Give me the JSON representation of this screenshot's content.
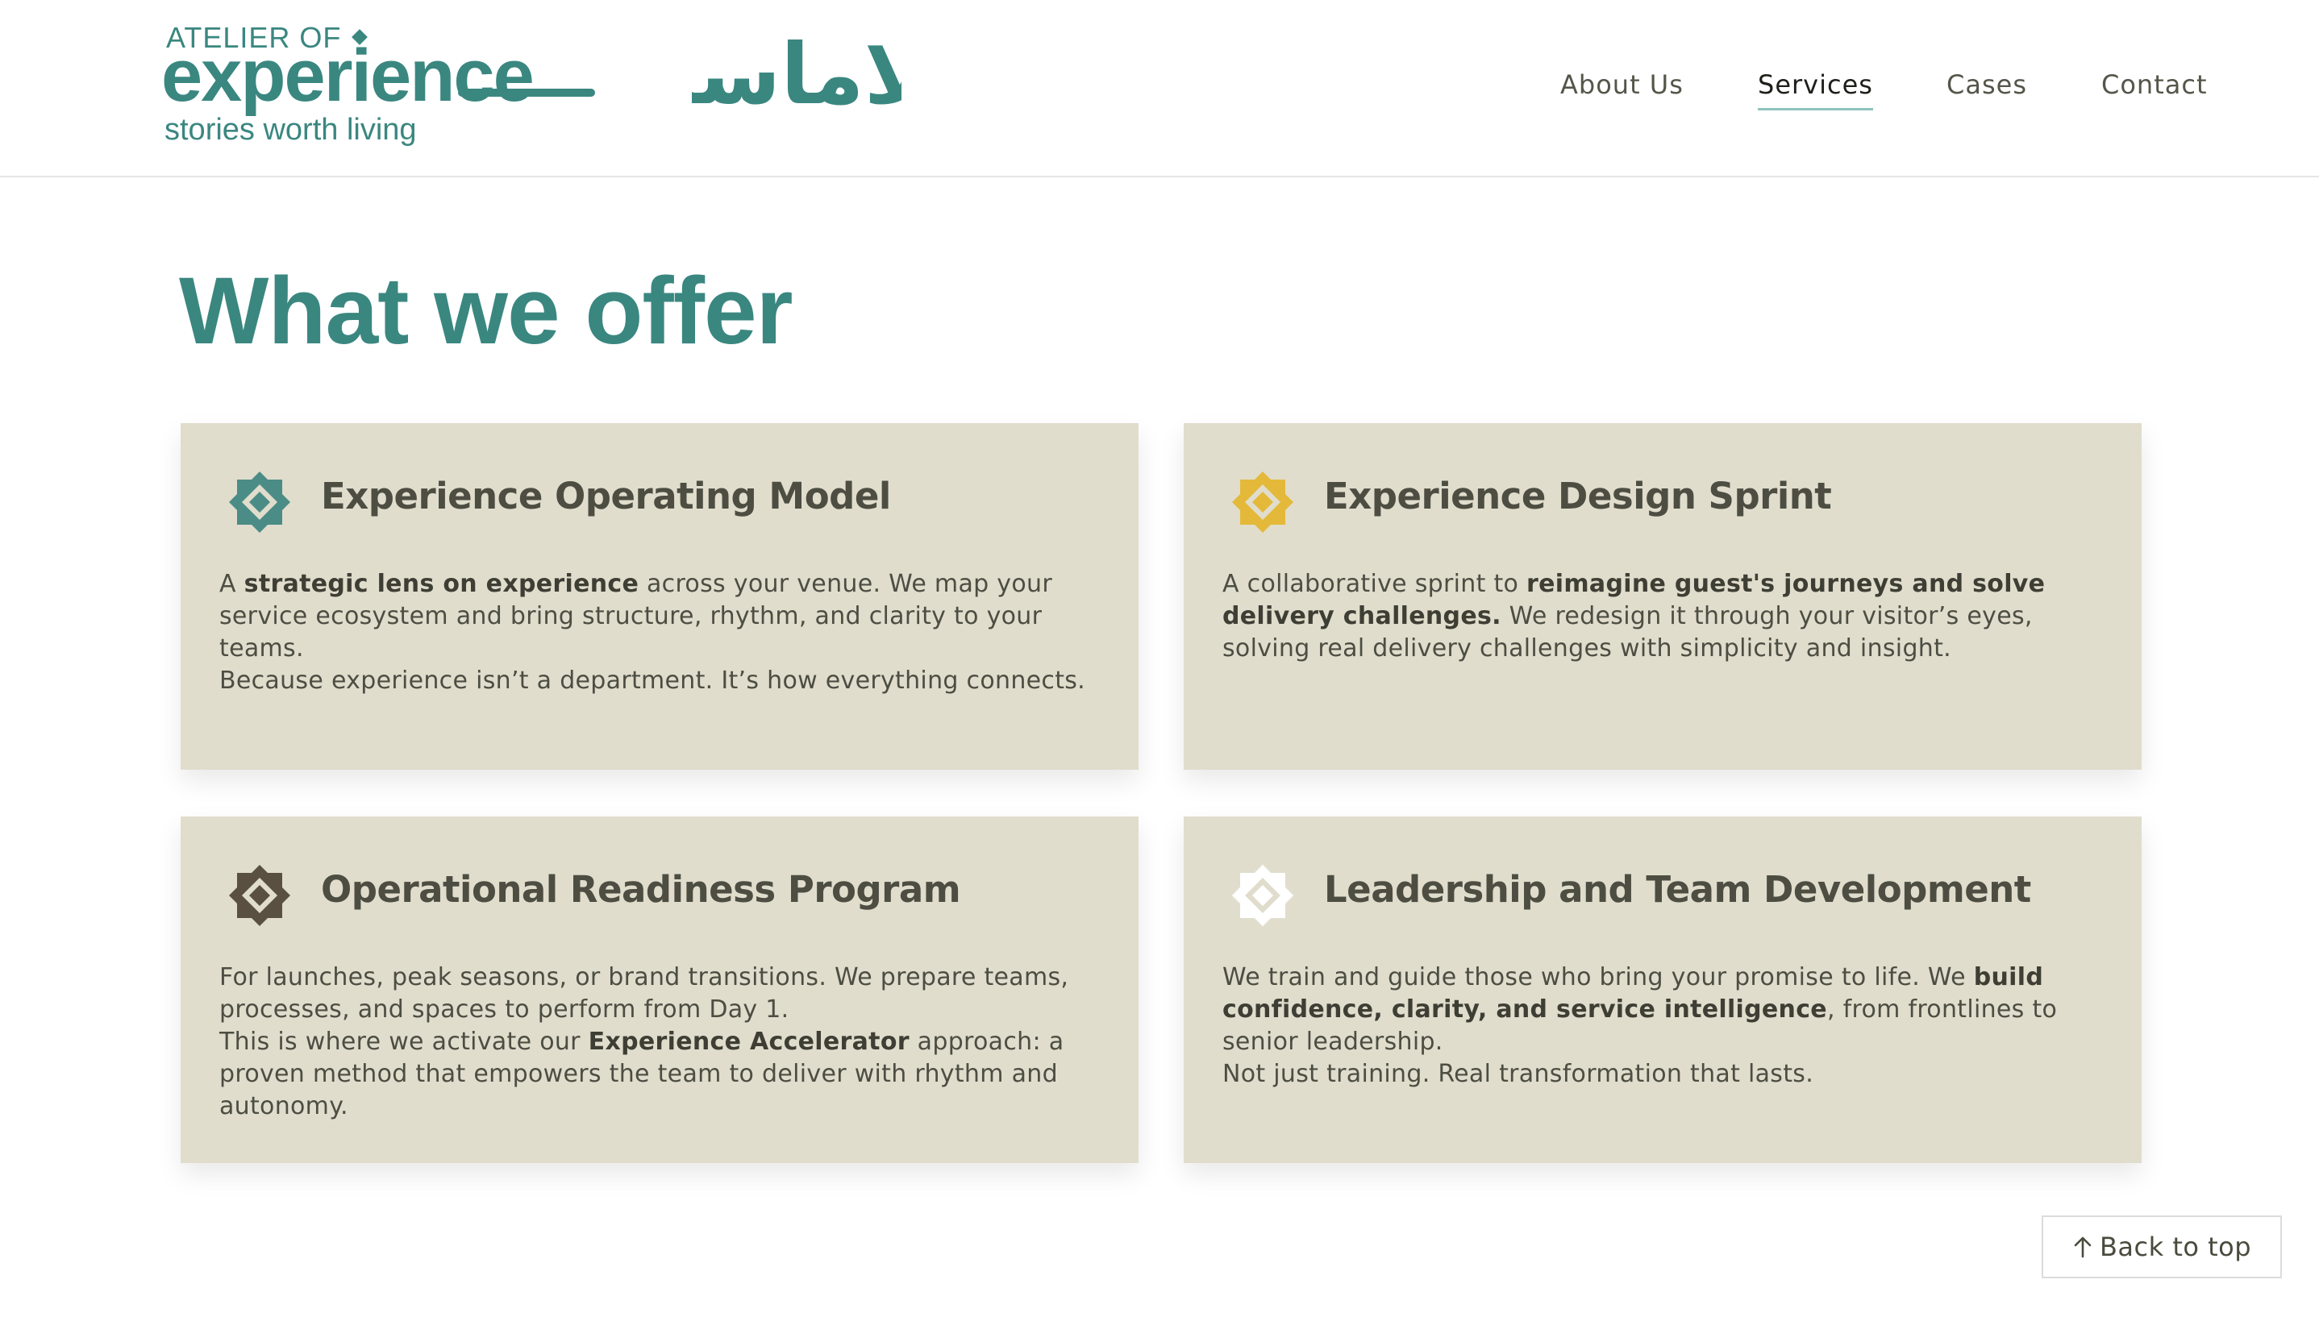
{
  "brand": {
    "top": "ATELIER OF",
    "main": "experience",
    "tagline": "stories worth living",
    "arabic": "لاماسا",
    "color": "#3a8780"
  },
  "nav": {
    "items": [
      {
        "label": "About Us",
        "active": false
      },
      {
        "label": "Services",
        "active": true
      },
      {
        "label": "Cases",
        "active": false
      },
      {
        "label": "Contact",
        "active": false
      }
    ]
  },
  "headline": "What we offer",
  "cards": [
    {
      "icon": "diamond-teal-icon",
      "icon_color": "#4b8c86",
      "title": "Experience Operating Model",
      "paragraphs": [
        [
          {
            "t": "A ",
            "b": false
          },
          {
            "t": "strategic lens on experience",
            "b": true
          },
          {
            "t": " across your venue. We map your service ecosystem and bring structure, rhythm, and clarity to your teams.",
            "b": false
          }
        ],
        [
          {
            "t": "Because experience isn’t a department. It’s how everything connects.",
            "b": false
          }
        ]
      ]
    },
    {
      "icon": "diamond-gold-icon",
      "icon_color": "#e4b93a",
      "title": "Experience Design Sprint",
      "paragraphs": [
        [
          {
            "t": "A collaborative sprint to ",
            "b": false
          },
          {
            "t": "reimagine guest's journeys and solve delivery challenges.",
            "b": true
          },
          {
            "t": " We redesign it through your visitor’s eyes, solving real delivery challenges with simplicity and insight.",
            "b": false
          }
        ]
      ]
    },
    {
      "icon": "diamond-brown-icon",
      "icon_color": "#5a5041",
      "title": "Operational Readiness Program",
      "paragraphs": [
        [
          {
            "t": "For launches, peak seasons, or brand transitions. We prepare teams, processes, and spaces to perform from Day 1.",
            "b": false
          }
        ],
        [
          {
            "t": "This is where we activate our ",
            "b": false
          },
          {
            "t": "Experience Accelerator",
            "b": true
          },
          {
            "t": " approach: a proven method that empowers the team to deliver with rhythm and autonomy.",
            "b": false
          }
        ]
      ]
    },
    {
      "icon": "diamond-white-icon",
      "icon_color": "#ffffff",
      "title": "Leadership and Team Development",
      "paragraphs": [
        [
          {
            "t": "We train and guide those who bring your promise to life. We ",
            "b": false
          },
          {
            "t": "build confidence, clarity, and service intelligence",
            "b": true
          },
          {
            "t": ", from frontlines to senior leadership.",
            "b": false
          }
        ],
        [
          {
            "t": "Not just training. Real transformation that lasts.",
            "b": false
          }
        ]
      ]
    }
  ],
  "back_to_top": {
    "label": "Back to top",
    "icon": "arrow-up-icon"
  }
}
